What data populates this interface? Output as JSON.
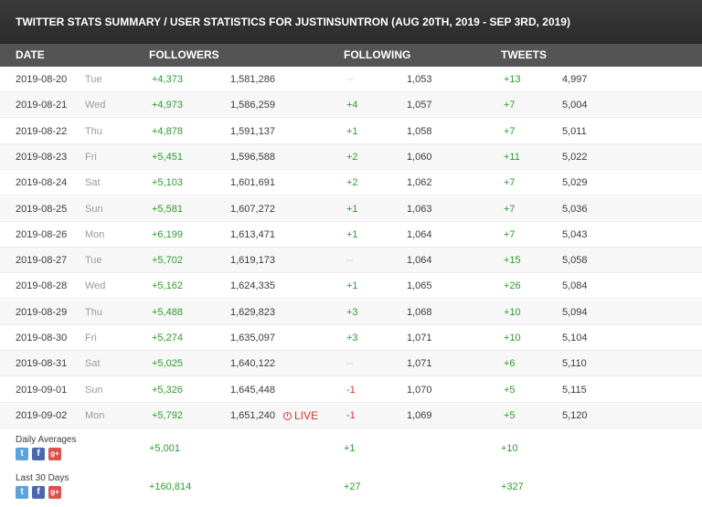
{
  "title": "TWITTER STATS SUMMARY / USER STATISTICS FOR JUSTINSUNTRON (AUG 20TH, 2019 - SEP 3RD, 2019)",
  "columns": {
    "date": "DATE",
    "followers": "FOLLOWERS",
    "following": "FOLLOWING",
    "tweets": "TWEETS"
  },
  "rows": [
    {
      "date": "2019-08-20",
      "day": "Tue",
      "followers_delta": "+4,373",
      "followers_total": "1,581,286",
      "following_delta": "--",
      "following_total": "1,053",
      "tweets_delta": "+13",
      "tweets_total": "4,997"
    },
    {
      "date": "2019-08-21",
      "day": "Wed",
      "followers_delta": "+4,973",
      "followers_total": "1,586,259",
      "following_delta": "+4",
      "following_total": "1,057",
      "tweets_delta": "+7",
      "tweets_total": "5,004"
    },
    {
      "date": "2019-08-22",
      "day": "Thu",
      "followers_delta": "+4,878",
      "followers_total": "1,591,137",
      "following_delta": "+1",
      "following_total": "1,058",
      "tweets_delta": "+7",
      "tweets_total": "5,011"
    },
    {
      "date": "2019-08-23",
      "day": "Fri",
      "followers_delta": "+5,451",
      "followers_total": "1,596,588",
      "following_delta": "+2",
      "following_total": "1,060",
      "tweets_delta": "+11",
      "tweets_total": "5,022"
    },
    {
      "date": "2019-08-24",
      "day": "Sat",
      "followers_delta": "+5,103",
      "followers_total": "1,601,691",
      "following_delta": "+2",
      "following_total": "1,062",
      "tweets_delta": "+7",
      "tweets_total": "5,029"
    },
    {
      "date": "2019-08-25",
      "day": "Sun",
      "followers_delta": "+5,581",
      "followers_total": "1,607,272",
      "following_delta": "+1",
      "following_total": "1,063",
      "tweets_delta": "+7",
      "tweets_total": "5,036"
    },
    {
      "date": "2019-08-26",
      "day": "Mon",
      "followers_delta": "+6,199",
      "followers_total": "1,613,471",
      "following_delta": "+1",
      "following_total": "1,064",
      "tweets_delta": "+7",
      "tweets_total": "5,043"
    },
    {
      "date": "2019-08-27",
      "day": "Tue",
      "followers_delta": "+5,702",
      "followers_total": "1,619,173",
      "following_delta": "--",
      "following_total": "1,064",
      "tweets_delta": "+15",
      "tweets_total": "5,058"
    },
    {
      "date": "2019-08-28",
      "day": "Wed",
      "followers_delta": "+5,162",
      "followers_total": "1,624,335",
      "following_delta": "+1",
      "following_total": "1,065",
      "tweets_delta": "+26",
      "tweets_total": "5,084"
    },
    {
      "date": "2019-08-29",
      "day": "Thu",
      "followers_delta": "+5,488",
      "followers_total": "1,629,823",
      "following_delta": "+3",
      "following_total": "1,068",
      "tweets_delta": "+10",
      "tweets_total": "5,094"
    },
    {
      "date": "2019-08-30",
      "day": "Fri",
      "followers_delta": "+5,274",
      "followers_total": "1,635,097",
      "following_delta": "+3",
      "following_total": "1,071",
      "tweets_delta": "+10",
      "tweets_total": "5,104"
    },
    {
      "date": "2019-08-31",
      "day": "Sat",
      "followers_delta": "+5,025",
      "followers_total": "1,640,122",
      "following_delta": "--",
      "following_total": "1,071",
      "tweets_delta": "+6",
      "tweets_total": "5,110"
    },
    {
      "date": "2019-09-01",
      "day": "Sun",
      "followers_delta": "+5,326",
      "followers_total": "1,645,448",
      "following_delta": "-1",
      "following_total": "1,070",
      "tweets_delta": "+5",
      "tweets_total": "5,115"
    },
    {
      "date": "2019-09-02",
      "day": "Mon",
      "followers_delta": "+5,792",
      "followers_total": "1,651,240",
      "following_delta": "-1",
      "following_total": "1,069",
      "tweets_delta": "+5",
      "tweets_total": "5,120",
      "live": "LIVE"
    }
  ],
  "summaries": [
    {
      "label": "Daily Averages",
      "followers": "+5,001",
      "following": "+1",
      "tweets": "+10"
    },
    {
      "label": "Last 30 Days",
      "followers": "+160,814",
      "following": "+27",
      "tweets": "+327"
    }
  ],
  "colors": {
    "title_bg": "#2b2b2b",
    "header_bg": "#545454",
    "positive": "#2e9a2e",
    "negative": "#d9342b",
    "live": "#d9342b"
  },
  "icons": [
    "twitter-icon",
    "facebook-icon",
    "google-plus-icon",
    "clock-icon"
  ]
}
